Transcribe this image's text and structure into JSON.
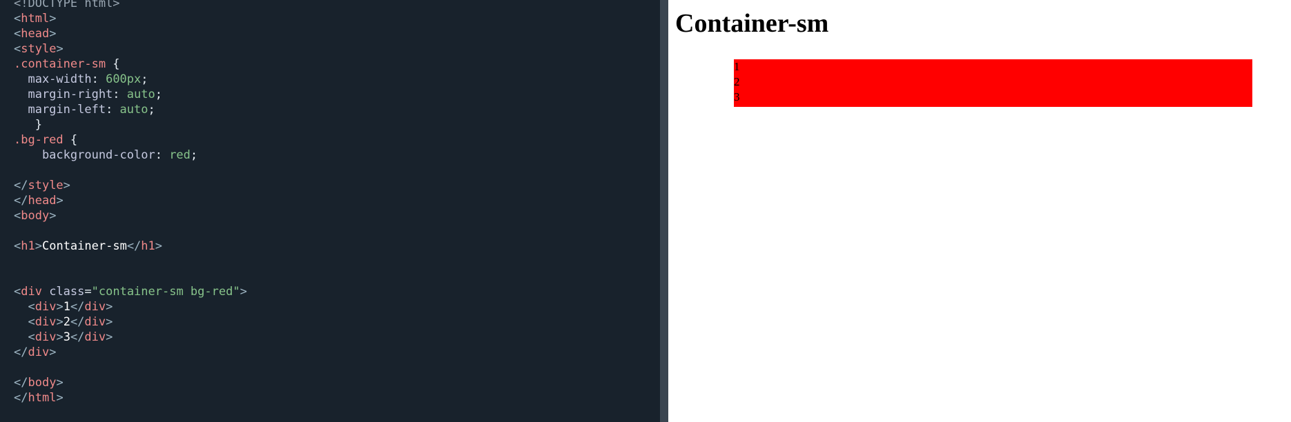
{
  "editor": {
    "lines": [
      [
        {
          "c": "tok-comment",
          "t": "<!DOCTYPE html>"
        }
      ],
      [
        {
          "c": "tok-bracket",
          "t": "<"
        },
        {
          "c": "tok-tag",
          "t": "html"
        },
        {
          "c": "tok-bracket",
          "t": ">"
        }
      ],
      [
        {
          "c": "tok-bracket",
          "t": "<"
        },
        {
          "c": "tok-tag",
          "t": "head"
        },
        {
          "c": "tok-bracket",
          "t": ">"
        }
      ],
      [
        {
          "c": "tok-bracket",
          "t": "<"
        },
        {
          "c": "tok-tag",
          "t": "style"
        },
        {
          "c": "tok-bracket",
          "t": ">"
        }
      ],
      [
        {
          "c": "tok-selector",
          "t": ".container-sm"
        },
        {
          "c": "tok-punct",
          "t": " {"
        }
      ],
      [
        {
          "c": "tok-prop",
          "t": "  max-width"
        },
        {
          "c": "tok-punct",
          "t": ": "
        },
        {
          "c": "tok-value",
          "t": "600px"
        },
        {
          "c": "tok-punct",
          "t": ";"
        }
      ],
      [
        {
          "c": "tok-prop",
          "t": "  margin-right"
        },
        {
          "c": "tok-punct",
          "t": ": "
        },
        {
          "c": "tok-value",
          "t": "auto"
        },
        {
          "c": "tok-punct",
          "t": ";"
        }
      ],
      [
        {
          "c": "tok-prop",
          "t": "  margin-left"
        },
        {
          "c": "tok-punct",
          "t": ": "
        },
        {
          "c": "tok-value",
          "t": "auto"
        },
        {
          "c": "tok-punct",
          "t": ";"
        }
      ],
      [
        {
          "c": "tok-punct",
          "t": "   }"
        }
      ],
      [
        {
          "c": "tok-selector",
          "t": ".bg-red"
        },
        {
          "c": "tok-punct",
          "t": " {"
        }
      ],
      [
        {
          "c": "tok-prop",
          "t": "    background-color"
        },
        {
          "c": "tok-punct",
          "t": ": "
        },
        {
          "c": "tok-value",
          "t": "red"
        },
        {
          "c": "tok-punct",
          "t": ";"
        }
      ],
      [],
      [
        {
          "c": "tok-bracket",
          "t": "</"
        },
        {
          "c": "tok-tag",
          "t": "style"
        },
        {
          "c": "tok-bracket",
          "t": ">"
        }
      ],
      [
        {
          "c": "tok-bracket",
          "t": "</"
        },
        {
          "c": "tok-tag",
          "t": "head"
        },
        {
          "c": "tok-bracket",
          "t": ">"
        }
      ],
      [
        {
          "c": "tok-bracket",
          "t": "<"
        },
        {
          "c": "tok-tag",
          "t": "body"
        },
        {
          "c": "tok-bracket",
          "t": ">"
        }
      ],
      [],
      [
        {
          "c": "tok-bracket",
          "t": "<"
        },
        {
          "c": "tok-tag",
          "t": "h1"
        },
        {
          "c": "tok-bracket",
          "t": ">"
        },
        {
          "c": "tok-text",
          "t": "Container-sm"
        },
        {
          "c": "tok-bracket",
          "t": "</"
        },
        {
          "c": "tok-tag",
          "t": "h1"
        },
        {
          "c": "tok-bracket",
          "t": ">"
        }
      ],
      [],
      [],
      [
        {
          "c": "tok-bracket",
          "t": "<"
        },
        {
          "c": "tok-tag",
          "t": "div"
        },
        {
          "c": "tok-attr",
          "t": " class"
        },
        {
          "c": "tok-punct",
          "t": "="
        },
        {
          "c": "tok-string",
          "t": "\"container-sm bg-red\""
        },
        {
          "c": "tok-bracket",
          "t": ">"
        }
      ],
      [
        {
          "c": "tok-bracket",
          "t": "  <"
        },
        {
          "c": "tok-tag",
          "t": "div"
        },
        {
          "c": "tok-bracket",
          "t": ">"
        },
        {
          "c": "tok-text",
          "t": "1"
        },
        {
          "c": "tok-bracket",
          "t": "</"
        },
        {
          "c": "tok-tag",
          "t": "div"
        },
        {
          "c": "tok-bracket",
          "t": ">"
        }
      ],
      [
        {
          "c": "tok-bracket",
          "t": "  <"
        },
        {
          "c": "tok-tag",
          "t": "div"
        },
        {
          "c": "tok-bracket",
          "t": ">"
        },
        {
          "c": "tok-text",
          "t": "2"
        },
        {
          "c": "tok-bracket",
          "t": "</"
        },
        {
          "c": "tok-tag",
          "t": "div"
        },
        {
          "c": "tok-bracket",
          "t": ">"
        }
      ],
      [
        {
          "c": "tok-bracket",
          "t": "  <"
        },
        {
          "c": "tok-tag",
          "t": "div"
        },
        {
          "c": "tok-bracket",
          "t": ">"
        },
        {
          "c": "tok-text",
          "t": "3"
        },
        {
          "c": "tok-bracket",
          "t": "</"
        },
        {
          "c": "tok-tag",
          "t": "div"
        },
        {
          "c": "tok-bracket",
          "t": ">"
        }
      ],
      [
        {
          "c": "tok-bracket",
          "t": "</"
        },
        {
          "c": "tok-tag",
          "t": "div"
        },
        {
          "c": "tok-bracket",
          "t": ">"
        }
      ],
      [],
      [
        {
          "c": "tok-bracket",
          "t": "</"
        },
        {
          "c": "tok-tag",
          "t": "body"
        },
        {
          "c": "tok-bracket",
          "t": ">"
        }
      ],
      [
        {
          "c": "tok-bracket",
          "t": "</"
        },
        {
          "c": "tok-tag",
          "t": "html"
        },
        {
          "c": "tok-bracket",
          "t": ">"
        }
      ]
    ]
  },
  "preview": {
    "heading": "Container-sm",
    "items": [
      "1",
      "2",
      "3"
    ],
    "box_color": "#ff0000"
  }
}
